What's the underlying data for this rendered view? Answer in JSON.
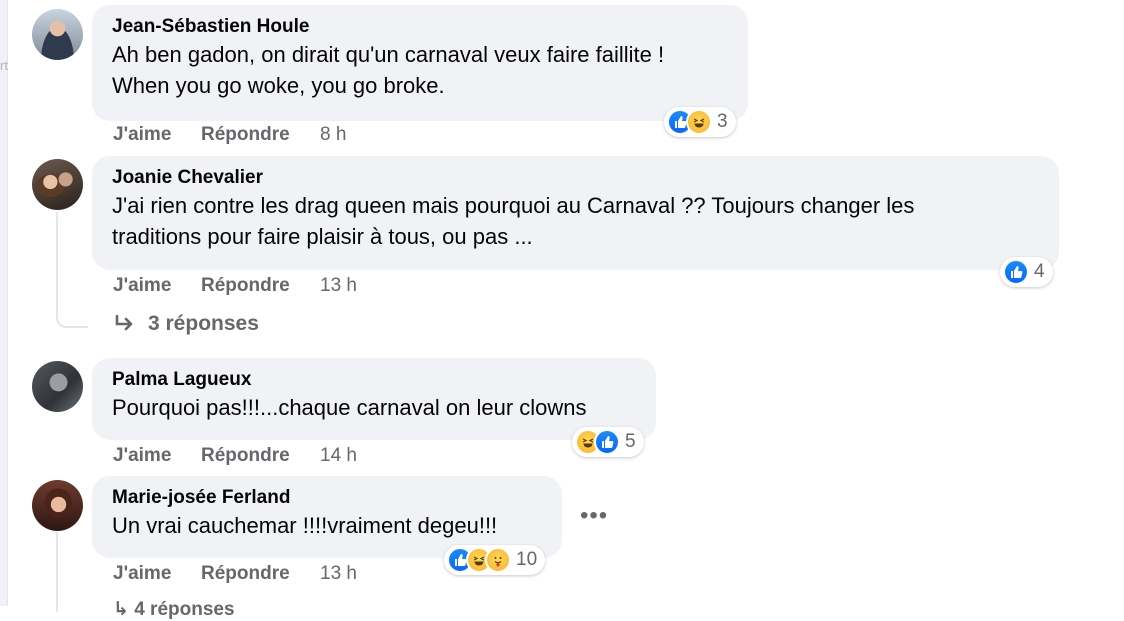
{
  "left_edge_mark": "rt",
  "comments": [
    {
      "author": "Jean-Sébastien Houle",
      "text": "Ah ben gadon, on dirait qu'un carnaval veux faire faillite !\nWhen you go woke, you go broke.",
      "like_label": "J'aime",
      "reply_label": "Répondre",
      "time": "8 h",
      "reactions": [
        "like",
        "haha"
      ],
      "reaction_count": "3"
    },
    {
      "author": "Joanie Chevalier",
      "text": "J'ai rien contre les drag queen mais pourquoi au Carnaval ?? Toujours changer les\ntraditions pour faire plaisir à tous, ou pas ...",
      "like_label": "J'aime",
      "reply_label": "Répondre",
      "time": "13 h",
      "reactions": [
        "like"
      ],
      "reaction_count": "4",
      "replies_label": "3 réponses"
    },
    {
      "author": "Palma Lagueux",
      "text": "Pourquoi pas!!!...chaque carnaval on leur clowns",
      "like_label": "J'aime",
      "reply_label": "Répondre",
      "time": "14 h",
      "reactions": [
        "haha",
        "like"
      ],
      "reaction_count": "5"
    },
    {
      "author": "Marie-josée Ferland",
      "text": "Un vrai cauchemar !!!!vraiment degeu!!!",
      "like_label": "J'aime",
      "reply_label": "Répondre",
      "time": "13 h",
      "reactions": [
        "like",
        "haha",
        "care"
      ],
      "reaction_count": "10",
      "more_label": "•••"
    }
  ],
  "cutoff_text": "↳ 4 réponses",
  "colors": {
    "bubble": "#f0f2f5",
    "secondary_text": "#65676b",
    "like_blue": "#0866ff",
    "haha_yellow": "#f7b125"
  }
}
